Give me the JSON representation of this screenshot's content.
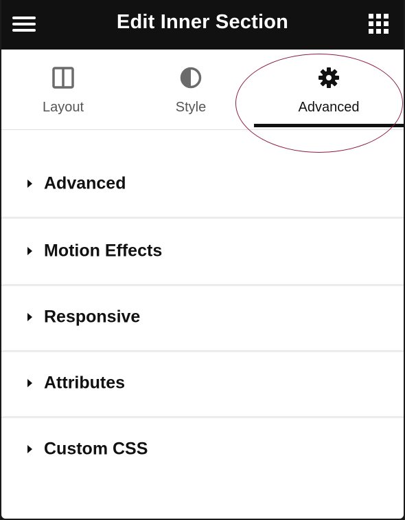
{
  "header": {
    "title": "Edit Inner Section",
    "menu_icon": "hamburger-menu-icon",
    "grid_icon": "widgets-grid-icon"
  },
  "tabs": [
    {
      "label": "Layout",
      "icon": "columns-layout-icon",
      "active": false
    },
    {
      "label": "Style",
      "icon": "half-circle-contrast-icon",
      "active": false
    },
    {
      "label": "Advanced",
      "icon": "gear-icon",
      "active": true
    }
  ],
  "sections": [
    {
      "label": "Advanced"
    },
    {
      "label": "Motion Effects"
    },
    {
      "label": "Responsive"
    },
    {
      "label": "Attributes"
    },
    {
      "label": "Custom CSS"
    }
  ],
  "colors": {
    "header_bg": "#111111",
    "active_underline": "#111111",
    "highlight_annotation": "#8b1a4a"
  }
}
